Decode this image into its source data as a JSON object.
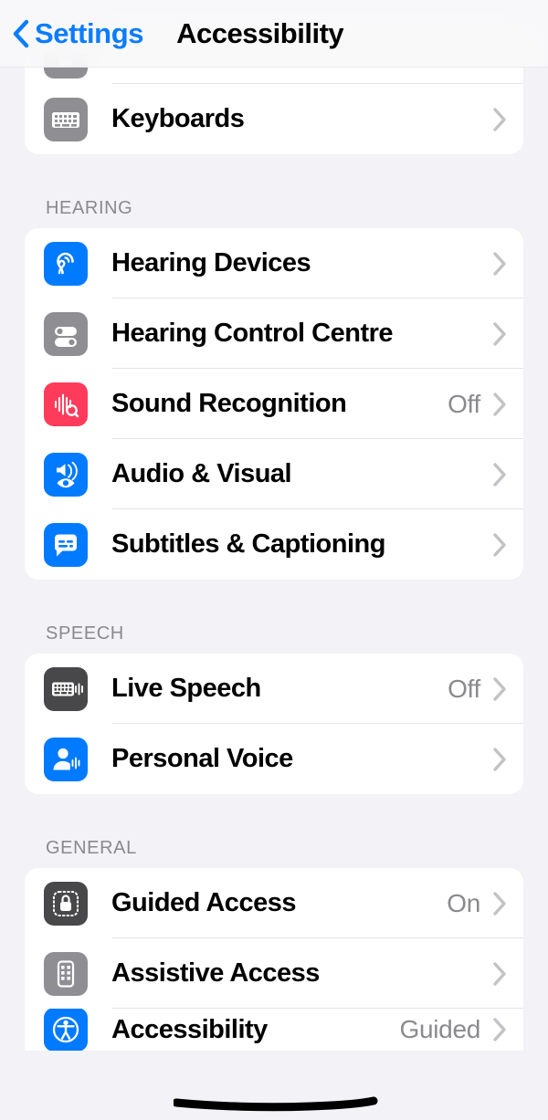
{
  "nav": {
    "back_label": "Settings",
    "back_icon": "chevron-left-icon",
    "title": "Accessibility"
  },
  "sections": [
    {
      "id": "partial-top",
      "header": "",
      "rows": [
        {
          "label": "",
          "value": "",
          "icon": "app-icon",
          "icon_color": "#8E8E93",
          "partial": "top"
        },
        {
          "label": "Keyboards",
          "value": "",
          "icon": "keyboard-icon",
          "icon_color": "#8E8E93"
        }
      ]
    },
    {
      "id": "hearing",
      "header": "HEARING",
      "rows": [
        {
          "label": "Hearing Devices",
          "value": "",
          "icon": "ear-icon",
          "icon_color": "#007AFF"
        },
        {
          "label": "Hearing Control Centre",
          "value": "",
          "icon": "toggles-icon",
          "icon_color": "#8E8E93"
        },
        {
          "label": "Sound Recognition",
          "value": "Off",
          "icon": "waveform-magnifier-icon",
          "icon_color": "#FF3B5C"
        },
        {
          "label": "Audio & Visual",
          "value": "",
          "icon": "speaker-eye-icon",
          "icon_color": "#007AFF"
        },
        {
          "label": "Subtitles & Captioning",
          "value": "",
          "icon": "captions-bubble-icon",
          "icon_color": "#007AFF"
        }
      ]
    },
    {
      "id": "speech",
      "header": "SPEECH",
      "rows": [
        {
          "label": "Live Speech",
          "value": "Off",
          "icon": "keyboard-waveform-icon",
          "icon_color": "#48484A"
        },
        {
          "label": "Personal Voice",
          "value": "",
          "icon": "person-waveform-icon",
          "icon_color": "#007AFF"
        }
      ]
    },
    {
      "id": "general",
      "header": "GENERAL",
      "rows": [
        {
          "label": "Guided Access",
          "value": "On",
          "icon": "lock-dotted-icon",
          "icon_color": "#48484A"
        },
        {
          "label": "Assistive Access",
          "value": "",
          "icon": "phone-grid-icon",
          "icon_color": "#8E8E93"
        },
        {
          "label": "Accessibility",
          "value": "Guided",
          "icon": "accessibility-person-icon",
          "icon_color": "#007AFF",
          "partial": "bottom",
          "redacted": true
        }
      ]
    }
  ],
  "colors": {
    "background": "#F2F2F7",
    "card": "#FFFFFF",
    "accent_blue": "#007AFF",
    "link_blue": "#0A7CFF",
    "secondary_text": "#8A8A8E",
    "separator": "#E5E5EA",
    "chevron": "#C2C2C7",
    "redaction_ink": "#000000"
  }
}
